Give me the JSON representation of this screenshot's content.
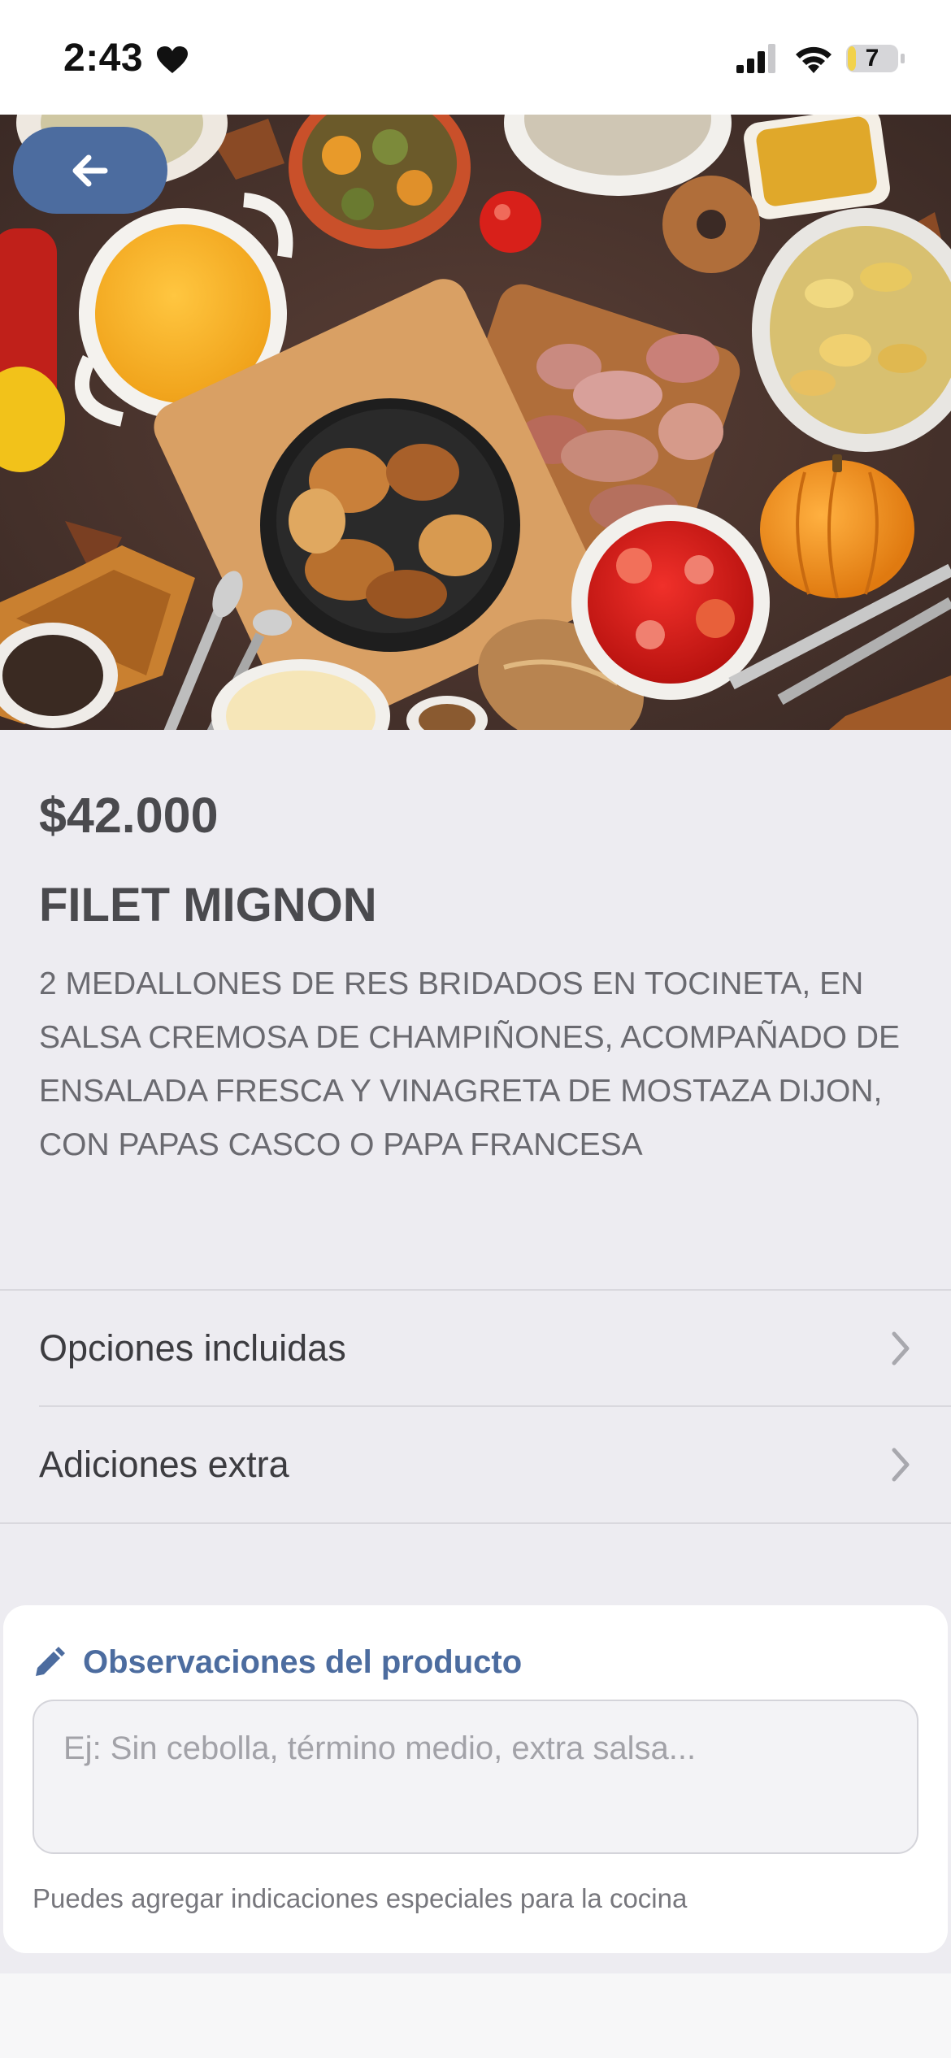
{
  "status_bar": {
    "time": "2:43",
    "battery_level": "7"
  },
  "product": {
    "price": "$42.000",
    "name": "FILET MIGNON",
    "description": "2 MEDALLONES DE RES BRIDADOS EN TOCINETA, EN SALSA CREMOSA DE CHAMPIÑONES, ACOMPAÑADO DE ENSALADA FRESCA Y VINAGRETA DE MOSTAZA DIJON, CON PAPAS CASCO O PAPA FRANCESA"
  },
  "options": [
    {
      "label": "Opciones incluidas"
    },
    {
      "label": "Adiciones extra"
    }
  ],
  "observations": {
    "title": "Observaciones del producto",
    "value": "",
    "placeholder": "Ej: Sin cebolla, término medio, extra salsa...",
    "hint": "Puedes agregar indicaciones especiales para la cocina"
  },
  "colors": {
    "accent": "#4c6c9f",
    "background": "#edecf1",
    "card": "#ffffff",
    "text": "#4a4a4e"
  },
  "icons": [
    "heart-icon",
    "cellular-signal-icon",
    "wifi-icon",
    "battery-icon",
    "back-arrow-icon",
    "chevron-right-icon",
    "pencil-icon"
  ]
}
